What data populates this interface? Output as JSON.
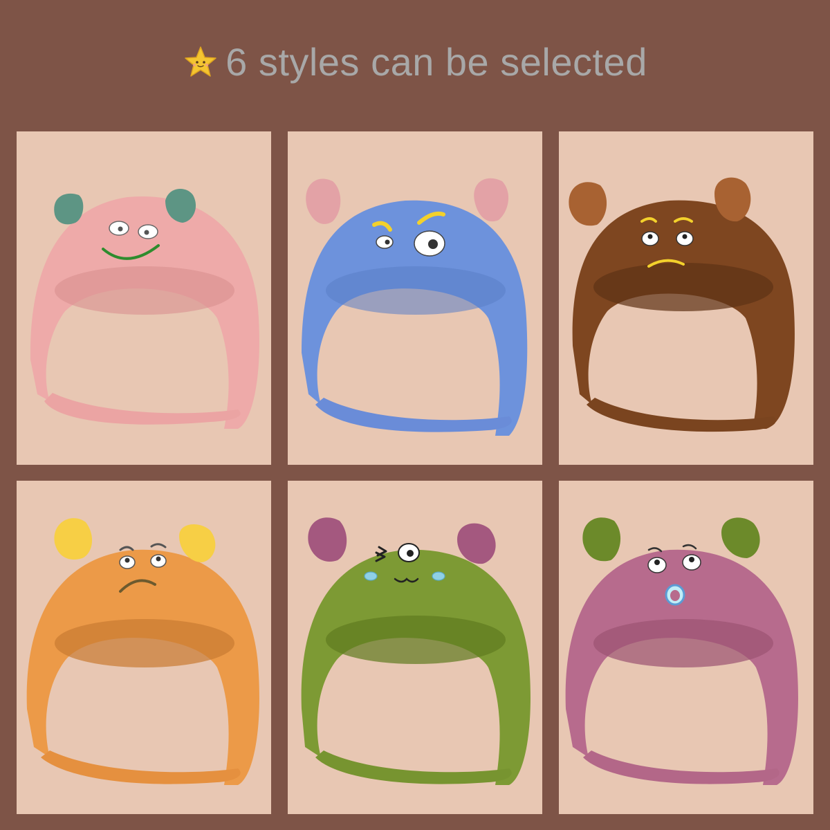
{
  "header": {
    "title": "6 styles can be selected",
    "icon": "star-icon"
  },
  "styles": [
    {
      "name": "pink",
      "hat_color": "#eeaaa9",
      "ear_color": "#5d9584",
      "inner_ear": "#3f7a6c"
    },
    {
      "name": "blue",
      "hat_color": "#6d92dc",
      "ear_color": "#e3a2a6",
      "inner_ear": "#f0b6b9"
    },
    {
      "name": "brown",
      "hat_color": "#7e4620",
      "ear_color": "#a86232",
      "inner_ear": "#c07636"
    },
    {
      "name": "orange",
      "hat_color": "#ec9a48",
      "ear_color": "#f7cf45",
      "inner_ear": "#f5b72d"
    },
    {
      "name": "green",
      "hat_color": "#7d9a34",
      "ear_color": "#a4587f",
      "inner_ear": "#bc6f95"
    },
    {
      "name": "purple",
      "hat_color": "#b76b8d",
      "ear_color": "#6c8a2a",
      "inner_ear": "#85a43c"
    }
  ]
}
